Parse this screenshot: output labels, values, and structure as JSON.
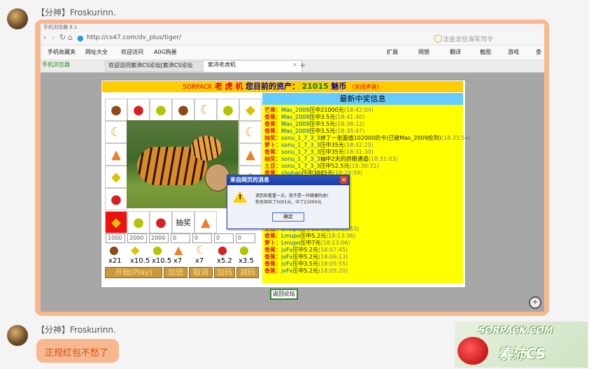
{
  "chat": {
    "sender1": "【分神】Froskurinn.",
    "sender2": "【分神】Froskurinn.",
    "reply": "正规红包不愁了"
  },
  "browser": {
    "title_partial": "手机浏览器 8.1",
    "url": "http://cs47.com/dv_plus/tiger/",
    "search_text": "沈金龙任海军司令",
    "bookmarks": [
      "手机收藏夹",
      "网址大全",
      "欢迎访问",
      "A0G狗屋"
    ],
    "right_tools": [
      "扩展",
      "网银",
      "翻译",
      "截图",
      "游戏",
      "查"
    ],
    "tabs": [
      {
        "label": "手机浏览器"
      },
      {
        "label": "欢迎访问索沛CS论坛[索沛CS论坛"
      },
      {
        "label": "索沛老虎机"
      }
    ],
    "new_tab": "+"
  },
  "game": {
    "title_brand": "SORPACK",
    "title_main": "老 虎 机",
    "assets_label": "您目前的资产：",
    "assets_value": "21015",
    "assets_unit": "魅币",
    "sound_toggle": "（关闭声音）",
    "grid_row1": [
      "coconut",
      "tomato",
      "apple",
      "coconut",
      "banana",
      "apple",
      "lemon"
    ],
    "grid_row7": [
      "lemon",
      "apple",
      "tomato",
      "抽奖",
      "orange",
      "",
      ""
    ],
    "left_col": [
      "banana",
      "orange",
      "lemon",
      "tomato"
    ],
    "right_col": [
      "banana",
      "orange",
      "lemon"
    ],
    "bets": [
      "1000",
      "2000",
      "2000",
      "0",
      "0",
      "0",
      "0"
    ],
    "multipliers": [
      "x21",
      "x10.5",
      "x10.5",
      "x7",
      "x7",
      "x5.2",
      "x3.5"
    ],
    "bet_icons": [
      "coconut",
      "lemon",
      "apple",
      "orange",
      "banana",
      "tomato",
      "apple"
    ],
    "buttons": [
      "开始(Play)",
      "加倍",
      "取消",
      "加码",
      "减码"
    ],
    "back_link": "返回论坛"
  },
  "winners": {
    "header": "最新中奖信息",
    "lines": [
      {
        "tag": "芒果：",
        "name": "Mas_2009",
        "text": "压中21000元",
        "time": "(18:42:04)"
      },
      {
        "tag": "香蕉：",
        "name": "Mas_2009",
        "text": "压中3.5元",
        "time": "(18:41:40)"
      },
      {
        "tag": "香蕉：",
        "name": "Mas_2009",
        "text": "压中3.5元",
        "time": "(18:38:12)"
      },
      {
        "tag": "香蕉：",
        "name": "Mas_2009",
        "text": "压中3.5元",
        "time": "(18:35:47)"
      },
      {
        "tag": "抽奖：",
        "name": "sonu_1_7_3_3",
        "text": "掉了一张面值102000的卡(已被Mas_2009捡到)",
        "time": "(18:33:54)"
      },
      {
        "tag": "萝卜：",
        "name": "sonu_1_7_3_3",
        "text": "压中35元",
        "time": "(18:32:25)"
      },
      {
        "tag": "香蕉：",
        "name": "sonu_1_7_3_3",
        "text": "压中35元",
        "time": "(18:31:30)"
      },
      {
        "tag": "抽奖：",
        "name": "sonu_1_7_3_3",
        "text": "抽中2天的挤眼通道",
        "time": "(18:31:03)"
      },
      {
        "tag": "土豆：",
        "name": "sonu_1_7_3_3",
        "text": "压中52.5元",
        "time": "(18:30:31)"
      },
      {
        "tag": "香蕉：",
        "name": "chuhan",
        "text": "压中3885元",
        "time": "(18:29:59)"
      },
      {
        "tag": "",
        "name": "",
        "text": "",
        "time": "(18:28:45)"
      },
      {
        "tag": "",
        "name": "",
        "text": "",
        "time": "(18:28:33)"
      },
      {
        "tag": "",
        "name": "",
        "text": "",
        "time": "(18:28:14)"
      },
      {
        "tag": "",
        "name": "",
        "text": "",
        "time": "(18:27:45)"
      },
      {
        "tag": "",
        "name": "",
        "text": "",
        "time": "(18:27:09)"
      },
      {
        "tag": "",
        "name": "",
        "text": "",
        "time": "(18:24:45)"
      },
      {
        "tag": "香蕉：",
        "name": "Lmupo",
        "text": "压中7元",
        "time": "(18:14:28)"
      },
      {
        "tag": "土豆：",
        "name": "Lmupo",
        "text": "压中10.5元",
        "time": "(18:13:53)"
      },
      {
        "tag": "香蕉：",
        "name": "Lmupo",
        "text": "压中5.2元",
        "time": "(18:13:36)"
      },
      {
        "tag": "萝卜：",
        "name": "Lmupo",
        "text": "压中7元",
        "time": "(18:13:06)"
      },
      {
        "tag": "香蕉：",
        "name": "jvFv",
        "text": "压中5.2元",
        "time": "(18:07:45)"
      },
      {
        "tag": "香蕉：",
        "name": "jvFv",
        "text": "压中5.2元",
        "time": "(18:06:13)"
      },
      {
        "tag": "香蕉：",
        "name": "jvFv",
        "text": "压中3.5元",
        "time": "(18:05:55)"
      },
      {
        "tag": "香蕉：",
        "name": "jvFv",
        "text": "压中5.2元",
        "time": "(18:05:20)"
      }
    ]
  },
  "dialog": {
    "title": "来自网页的消息",
    "line1": "请您前看重一点，我不是一只随便的虎!",
    "line2": "你总共压了5001元，中了21000元",
    "ok": "确定",
    "close": "✕"
  },
  "watermark": {
    "top": "SORPACK.COM",
    "bottom": "索沛CS"
  },
  "colors": {
    "bubble": "#f7b88f",
    "game_yellow": "#ffff00",
    "header_blue": "#66ccff",
    "title_red": "#e1001a"
  }
}
